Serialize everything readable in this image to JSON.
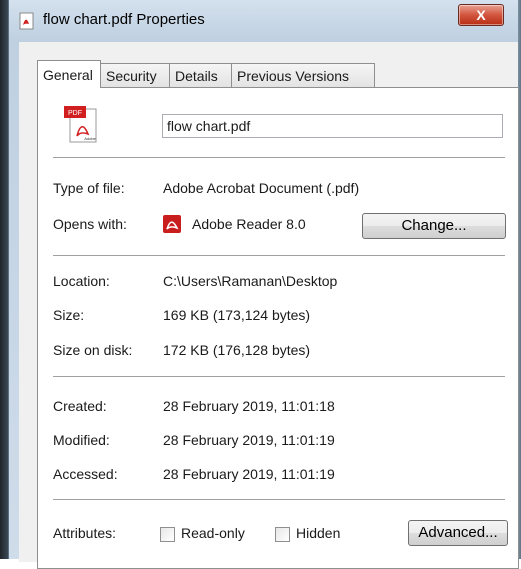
{
  "window": {
    "title": "flow chart.pdf Properties",
    "close_label": "X"
  },
  "tabs": [
    {
      "label": "General",
      "active": true
    },
    {
      "label": "Security",
      "active": false
    },
    {
      "label": "Details",
      "active": false
    },
    {
      "label": "Previous Versions",
      "active": false
    }
  ],
  "file": {
    "name": "flow chart.pdf",
    "icon_text": "PDF",
    "icon_subtext": "Adobe"
  },
  "general": {
    "type_label": "Type of file:",
    "type_value": "Adobe Acrobat Document (.pdf)",
    "opens_label": "Opens with:",
    "opens_value": "Adobe Reader 8.0",
    "change_button": "Change...",
    "location_label": "Location:",
    "location_value": "C:\\Users\\Ramanan\\Desktop",
    "size_label": "Size:",
    "size_value": "169 KB (173,124 bytes)",
    "size_on_disk_label": "Size on disk:",
    "size_on_disk_value": "172 KB (176,128 bytes)",
    "created_label": "Created:",
    "created_value": "28 February 2019, 11:01:18",
    "modified_label": "Modified:",
    "modified_value": "28 February 2019, 11:01:19",
    "accessed_label": "Accessed:",
    "accessed_value": "28 February 2019, 11:01:19",
    "attributes_label": "Attributes:",
    "readonly_label": "Read-only",
    "hidden_label": "Hidden",
    "advanced_button": "Advanced..."
  },
  "colors": {
    "accent_red": "#d11f1f",
    "title_gradient": "#bfd0e1"
  }
}
